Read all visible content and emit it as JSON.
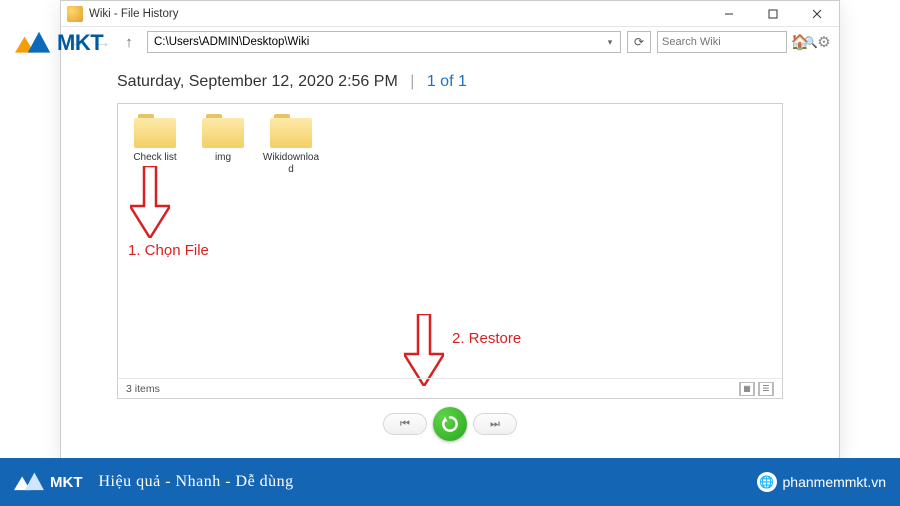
{
  "window": {
    "title": "Wiki - File History",
    "address": "C:\\Users\\ADMIN\\Desktop\\Wiki",
    "search_placeholder": "Search Wiki"
  },
  "heading": {
    "timestamp": "Saturday, September 12, 2020 2:56 PM",
    "separator": "|",
    "count": "1 of 1"
  },
  "folders": [
    {
      "label": "Check list"
    },
    {
      "label": "img"
    },
    {
      "label": "Wikidownload"
    }
  ],
  "status": {
    "text": "3 items"
  },
  "annotations": {
    "step1": "1. Chọn File",
    "step2": "2. Restore"
  },
  "overlay_logo": {
    "text": "MKT"
  },
  "footer": {
    "logo_text": "MKT",
    "slogan": "Hiệu quả - Nhanh  - Dễ dùng",
    "url": "phanmemmkt.vn"
  }
}
